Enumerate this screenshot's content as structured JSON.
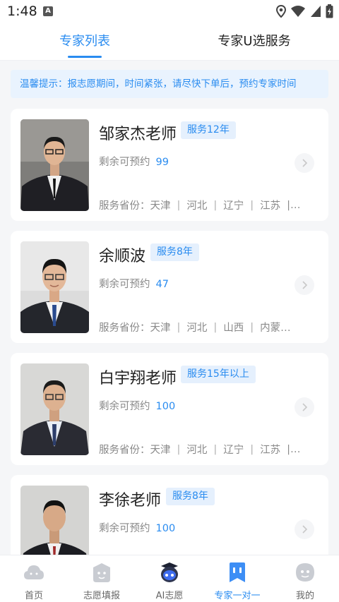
{
  "status_bar": {
    "time": "1:48",
    "notification_icon": "A"
  },
  "tabs": [
    {
      "label": "专家列表",
      "active": true
    },
    {
      "label": "专家U选服务",
      "active": false
    }
  ],
  "notice": "温馨提示：报志愿期间，时间紧张，请尽快下单后，预约专家时间",
  "experts": [
    {
      "name": "邹家杰老师",
      "badge": "服务12年",
      "remain_label": "剩余可预约",
      "remain_count": "99",
      "provinces_label": "服务省份：",
      "provinces": [
        "天津",
        "河北",
        "辽宁",
        "江苏",
        "|…"
      ]
    },
    {
      "name": "余顺波",
      "badge": "服务8年",
      "remain_label": "剩余可预约",
      "remain_count": "47",
      "provinces_label": "服务省份：",
      "provinces": [
        "天津",
        "河北",
        "山西",
        "内蒙…"
      ]
    },
    {
      "name": "白宇翔老师",
      "badge": "服务15年以上",
      "remain_label": "剩余可预约",
      "remain_count": "100",
      "provinces_label": "服务省份：",
      "provinces": [
        "天津",
        "河北",
        "辽宁",
        "江苏",
        "|…"
      ]
    },
    {
      "name": "李徐老师",
      "badge": "服务8年",
      "remain_label": "剩余可预约",
      "remain_count": "100"
    }
  ],
  "nav": [
    {
      "label": "首页",
      "icon": "home-cloud-icon",
      "active": false
    },
    {
      "label": "志愿填报",
      "icon": "application-icon",
      "active": false
    },
    {
      "label": "AI志愿",
      "icon": "ai-robot-icon",
      "active": false
    },
    {
      "label": "专家一对一",
      "icon": "expert-chat-icon",
      "active": true
    },
    {
      "label": "我的",
      "icon": "profile-icon",
      "active": false
    }
  ],
  "colors": {
    "accent": "#2a8cf0",
    "badge_bg": "#e5f0fd",
    "notice_bg": "#e9f3fe",
    "page_bg": "#f5f6f8"
  }
}
